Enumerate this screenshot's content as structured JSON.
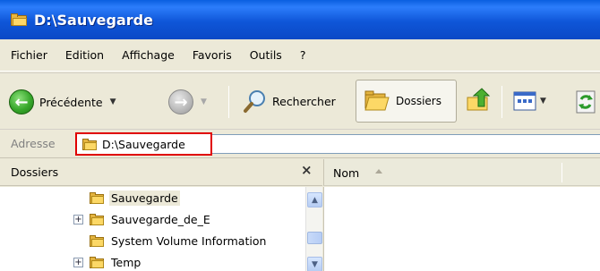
{
  "window": {
    "title": "D:\\Sauvegarde"
  },
  "menu": [
    "Fichier",
    "Edition",
    "Affichage",
    "Favoris",
    "Outils",
    "?"
  ],
  "toolbar": {
    "back_label": "Précédente",
    "search_label": "Rechercher",
    "folders_label": "Dossiers"
  },
  "address": {
    "label": "Adresse",
    "value": "D:\\Sauvegarde"
  },
  "folders_pane": {
    "title": "Dossiers",
    "close": "×",
    "items": [
      {
        "label": "Sauvegarde",
        "expander": "",
        "selected": true
      },
      {
        "label": "Sauvegarde_de_E",
        "expander": "+",
        "selected": false
      },
      {
        "label": "System Volume Information",
        "expander": "",
        "selected": false
      },
      {
        "label": "Temp",
        "expander": "+",
        "selected": false
      }
    ]
  },
  "file_list": {
    "column_name": "Nom"
  },
  "icons": {
    "back": "back-arrow-icon",
    "forward": "forward-arrow-icon",
    "search": "magnifier-icon",
    "folders": "folders-icon",
    "up": "up-folder-icon",
    "views": "views-icon",
    "refresh": "sync-icon"
  },
  "colors": {
    "titlebar": "#0a55e0",
    "highlight_box": "#e00000",
    "back_button": "#38a82c"
  }
}
